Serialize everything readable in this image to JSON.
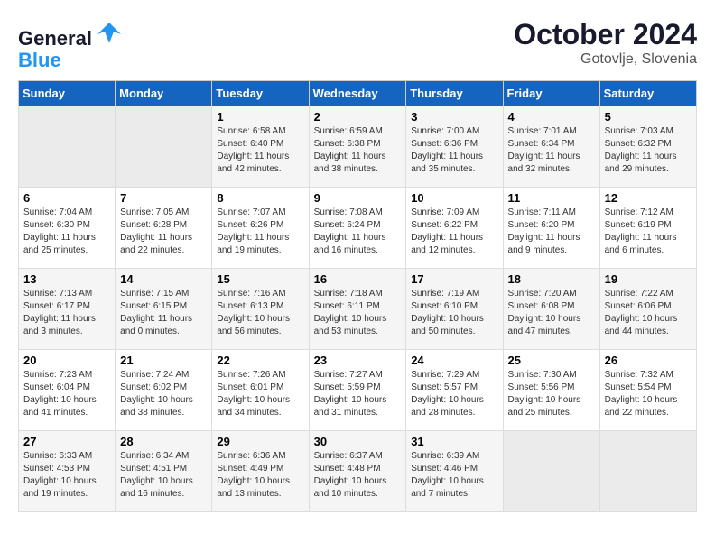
{
  "header": {
    "logo_line1": "General",
    "logo_line2": "Blue",
    "month": "October 2024",
    "location": "Gotovlje, Slovenia"
  },
  "days_of_week": [
    "Sunday",
    "Monday",
    "Tuesday",
    "Wednesday",
    "Thursday",
    "Friday",
    "Saturday"
  ],
  "weeks": [
    [
      {
        "day": "",
        "empty": true
      },
      {
        "day": "",
        "empty": true
      },
      {
        "day": "1",
        "sunrise": "6:58 AM",
        "sunset": "6:40 PM",
        "daylight": "11 hours and 42 minutes."
      },
      {
        "day": "2",
        "sunrise": "6:59 AM",
        "sunset": "6:38 PM",
        "daylight": "11 hours and 38 minutes."
      },
      {
        "day": "3",
        "sunrise": "7:00 AM",
        "sunset": "6:36 PM",
        "daylight": "11 hours and 35 minutes."
      },
      {
        "day": "4",
        "sunrise": "7:01 AM",
        "sunset": "6:34 PM",
        "daylight": "11 hours and 32 minutes."
      },
      {
        "day": "5",
        "sunrise": "7:03 AM",
        "sunset": "6:32 PM",
        "daylight": "11 hours and 29 minutes."
      }
    ],
    [
      {
        "day": "6",
        "sunrise": "7:04 AM",
        "sunset": "6:30 PM",
        "daylight": "11 hours and 25 minutes."
      },
      {
        "day": "7",
        "sunrise": "7:05 AM",
        "sunset": "6:28 PM",
        "daylight": "11 hours and 22 minutes."
      },
      {
        "day": "8",
        "sunrise": "7:07 AM",
        "sunset": "6:26 PM",
        "daylight": "11 hours and 19 minutes."
      },
      {
        "day": "9",
        "sunrise": "7:08 AM",
        "sunset": "6:24 PM",
        "daylight": "11 hours and 16 minutes."
      },
      {
        "day": "10",
        "sunrise": "7:09 AM",
        "sunset": "6:22 PM",
        "daylight": "11 hours and 12 minutes."
      },
      {
        "day": "11",
        "sunrise": "7:11 AM",
        "sunset": "6:20 PM",
        "daylight": "11 hours and 9 minutes."
      },
      {
        "day": "12",
        "sunrise": "7:12 AM",
        "sunset": "6:19 PM",
        "daylight": "11 hours and 6 minutes."
      }
    ],
    [
      {
        "day": "13",
        "sunrise": "7:13 AM",
        "sunset": "6:17 PM",
        "daylight": "11 hours and 3 minutes."
      },
      {
        "day": "14",
        "sunrise": "7:15 AM",
        "sunset": "6:15 PM",
        "daylight": "11 hours and 0 minutes."
      },
      {
        "day": "15",
        "sunrise": "7:16 AM",
        "sunset": "6:13 PM",
        "daylight": "10 hours and 56 minutes."
      },
      {
        "day": "16",
        "sunrise": "7:18 AM",
        "sunset": "6:11 PM",
        "daylight": "10 hours and 53 minutes."
      },
      {
        "day": "17",
        "sunrise": "7:19 AM",
        "sunset": "6:10 PM",
        "daylight": "10 hours and 50 minutes."
      },
      {
        "day": "18",
        "sunrise": "7:20 AM",
        "sunset": "6:08 PM",
        "daylight": "10 hours and 47 minutes."
      },
      {
        "day": "19",
        "sunrise": "7:22 AM",
        "sunset": "6:06 PM",
        "daylight": "10 hours and 44 minutes."
      }
    ],
    [
      {
        "day": "20",
        "sunrise": "7:23 AM",
        "sunset": "6:04 PM",
        "daylight": "10 hours and 41 minutes."
      },
      {
        "day": "21",
        "sunrise": "7:24 AM",
        "sunset": "6:02 PM",
        "daylight": "10 hours and 38 minutes."
      },
      {
        "day": "22",
        "sunrise": "7:26 AM",
        "sunset": "6:01 PM",
        "daylight": "10 hours and 34 minutes."
      },
      {
        "day": "23",
        "sunrise": "7:27 AM",
        "sunset": "5:59 PM",
        "daylight": "10 hours and 31 minutes."
      },
      {
        "day": "24",
        "sunrise": "7:29 AM",
        "sunset": "5:57 PM",
        "daylight": "10 hours and 28 minutes."
      },
      {
        "day": "25",
        "sunrise": "7:30 AM",
        "sunset": "5:56 PM",
        "daylight": "10 hours and 25 minutes."
      },
      {
        "day": "26",
        "sunrise": "7:32 AM",
        "sunset": "5:54 PM",
        "daylight": "10 hours and 22 minutes."
      }
    ],
    [
      {
        "day": "27",
        "sunrise": "6:33 AM",
        "sunset": "4:53 PM",
        "daylight": "10 hours and 19 minutes."
      },
      {
        "day": "28",
        "sunrise": "6:34 AM",
        "sunset": "4:51 PM",
        "daylight": "10 hours and 16 minutes."
      },
      {
        "day": "29",
        "sunrise": "6:36 AM",
        "sunset": "4:49 PM",
        "daylight": "10 hours and 13 minutes."
      },
      {
        "day": "30",
        "sunrise": "6:37 AM",
        "sunset": "4:48 PM",
        "daylight": "10 hours and 10 minutes."
      },
      {
        "day": "31",
        "sunrise": "6:39 AM",
        "sunset": "4:46 PM",
        "daylight": "10 hours and 7 minutes."
      },
      {
        "day": "",
        "empty": true
      },
      {
        "day": "",
        "empty": true
      }
    ]
  ]
}
